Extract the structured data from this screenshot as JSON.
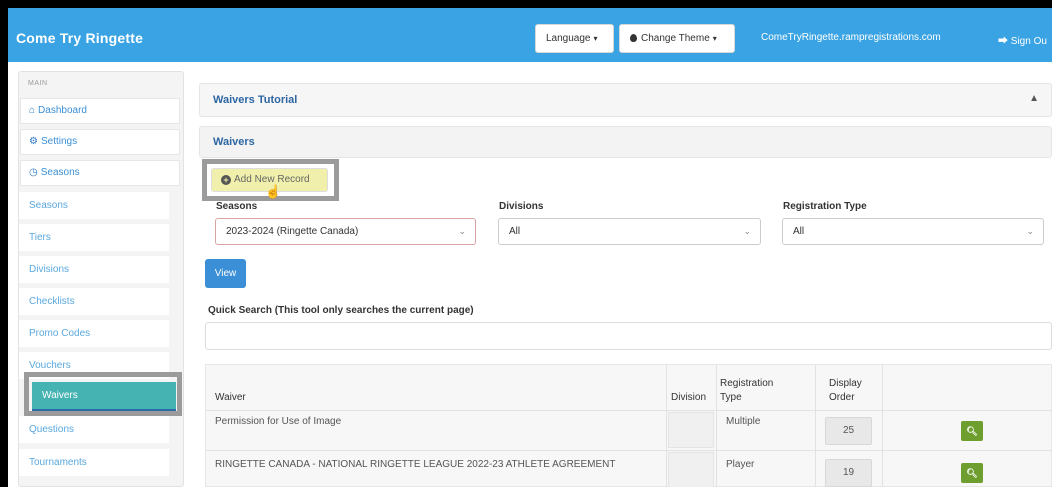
{
  "navbar": {
    "brand": "Come Try Ringette",
    "language_label": "Language",
    "theme_label": "Change Theme",
    "domain": "ComeTryRingette.rampregistrations.com",
    "signout_label": "Sign Ou"
  },
  "sidebar": {
    "section": "MAIN",
    "items": [
      {
        "label": "Dashboard",
        "icon": "home-icon"
      },
      {
        "label": "Settings",
        "icon": "gear-icon"
      },
      {
        "label": "Seasons",
        "icon": "clock-icon"
      }
    ],
    "subitems": [
      {
        "label": "Seasons"
      },
      {
        "label": "Tiers"
      },
      {
        "label": "Divisions"
      },
      {
        "label": "Checklists"
      },
      {
        "label": "Promo Codes"
      },
      {
        "label": "Vouchers"
      },
      {
        "label": "Waivers",
        "active": true
      },
      {
        "label": "Questions"
      },
      {
        "label": "Tournaments"
      }
    ]
  },
  "main": {
    "tutorial_title": "Waivers Tutorial",
    "waivers_title": "Waivers",
    "add_button": "Add New Record",
    "filters": {
      "seasons_label": "Seasons",
      "seasons_value": "2023-2024 (Ringette Canada)",
      "divisions_label": "Divisions",
      "divisions_value": "All",
      "regtype_label": "Registration Type",
      "regtype_value": "All"
    },
    "view_button": "View",
    "quick_search_label": "Quick Search (This tool only searches the current page)",
    "quick_search_value": ""
  },
  "table": {
    "headers": {
      "waiver": "Waiver",
      "division": "Division",
      "regtype_line1": "Registration",
      "regtype_line2": "Type",
      "order_line1": "Display",
      "order_line2": "Order"
    },
    "rows": [
      {
        "waiver": "Permission for Use of Image",
        "division": "",
        "regtype": "Multiple",
        "order": "25"
      },
      {
        "waiver": "RINGETTE CANADA - NATIONAL RINGETTE LEAGUE 2022-23 ATHLETE AGREEMENT",
        "division": "",
        "regtype": "Player",
        "order": "19"
      }
    ]
  },
  "colors": {
    "navbar": "#3aa3e3",
    "highlight_yellow": "#f0f0ac",
    "active_teal": "#46b3b3",
    "link_blue": "#3a8fd6",
    "view_button": "#3a8fd6",
    "zoom_button": "#6e9e2e"
  }
}
